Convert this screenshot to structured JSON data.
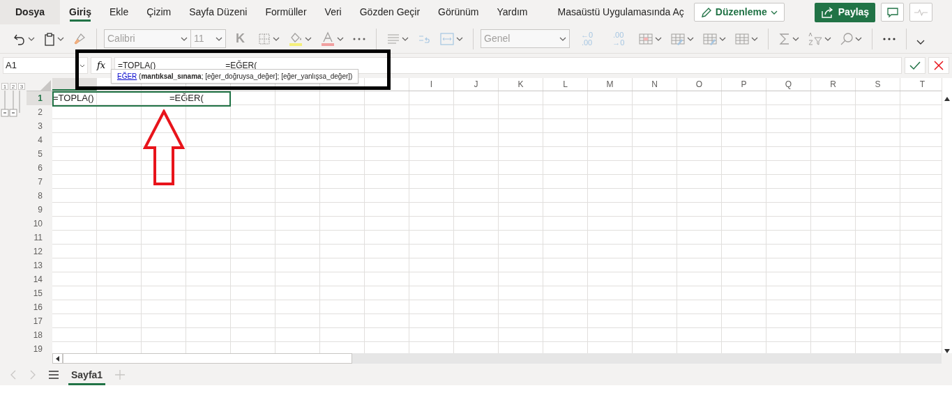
{
  "menu_tabs": [
    {
      "label": "Dosya",
      "kind": "file",
      "selected": false
    },
    {
      "label": "Giriş",
      "kind": "tab",
      "selected": true
    },
    {
      "label": "Ekle",
      "kind": "tab",
      "selected": false
    },
    {
      "label": "Çizim",
      "kind": "tab",
      "selected": false
    },
    {
      "label": "Sayfa Düzeni",
      "kind": "tab",
      "selected": false
    },
    {
      "label": "Formüller",
      "kind": "tab",
      "selected": false
    },
    {
      "label": "Veri",
      "kind": "tab",
      "selected": false
    },
    {
      "label": "Gözden Geçir",
      "kind": "tab",
      "selected": false
    },
    {
      "label": "Görünüm",
      "kind": "tab",
      "selected": false
    },
    {
      "label": "Yardım",
      "kind": "tab",
      "selected": false
    }
  ],
  "open_desktop": "Masaüstü Uygulamasında Aç",
  "edit_mode": "Düzenleme",
  "share": "Paylaş",
  "ribbon": {
    "font_name": "Calibri",
    "font_size": "11",
    "bold": "K",
    "number_format": "Genel",
    "decimal_increase": [
      "←0",
      ".00"
    ],
    "decimal_decrease": [
      ".00",
      "→0"
    ]
  },
  "formula_bar": {
    "name_box": "A1",
    "fx": "fx",
    "value": "=TOPLA()                              =EĞER("
  },
  "tooltip": {
    "function": "EĞER",
    "signature": "(**mantıksal_sınama**; [eğer_doğruysa_değer]; [eğer_yanlışsa_değer])"
  },
  "outline_levels": [
    "1",
    "2",
    "3"
  ],
  "columns": [
    {
      "selected": true
    },
    {
      "selected": false
    },
    {
      "selected": false
    },
    {
      "selected": false
    },
    {
      "selected": false
    },
    {
      "selected": false
    },
    {
      "selected": false
    },
    {
      "selected": false
    },
    {
      "label": "I",
      "selected": false
    },
    {
      "label": "J",
      "selected": false
    },
    {
      "label": "K",
      "selected": false
    },
    {
      "label": "L",
      "selected": false
    },
    {
      "label": "M",
      "selected": false
    },
    {
      "label": "N",
      "selected": false
    },
    {
      "label": "O",
      "selected": false
    },
    {
      "label": "P",
      "selected": false
    },
    {
      "label": "Q",
      "selected": false
    },
    {
      "label": "R",
      "selected": false
    },
    {
      "label": "S",
      "selected": false
    },
    {
      "label": "T",
      "selected": false
    }
  ],
  "rows": [
    {
      "label": "1",
      "selected": true,
      "cell_a": "=TOPLA()                              =EĞER("
    },
    {
      "label": "2",
      "selected": false
    },
    {
      "label": "3",
      "selected": false
    },
    {
      "label": "4",
      "selected": false
    },
    {
      "label": "5",
      "selected": false
    },
    {
      "label": "6",
      "selected": false
    },
    {
      "label": "7",
      "selected": false
    },
    {
      "label": "8",
      "selected": false
    },
    {
      "label": "9",
      "selected": false
    },
    {
      "label": "10",
      "selected": false
    },
    {
      "label": "11",
      "selected": false
    },
    {
      "label": "12",
      "selected": false
    },
    {
      "label": "13",
      "selected": false
    },
    {
      "label": "14",
      "selected": false
    },
    {
      "label": "15",
      "selected": false
    },
    {
      "label": "16",
      "selected": false
    },
    {
      "label": "17",
      "selected": false
    },
    {
      "label": "18",
      "selected": false
    },
    {
      "label": "19",
      "selected": false
    }
  ],
  "sheets": [
    {
      "label": "Sayfa1",
      "selected": true
    }
  ]
}
